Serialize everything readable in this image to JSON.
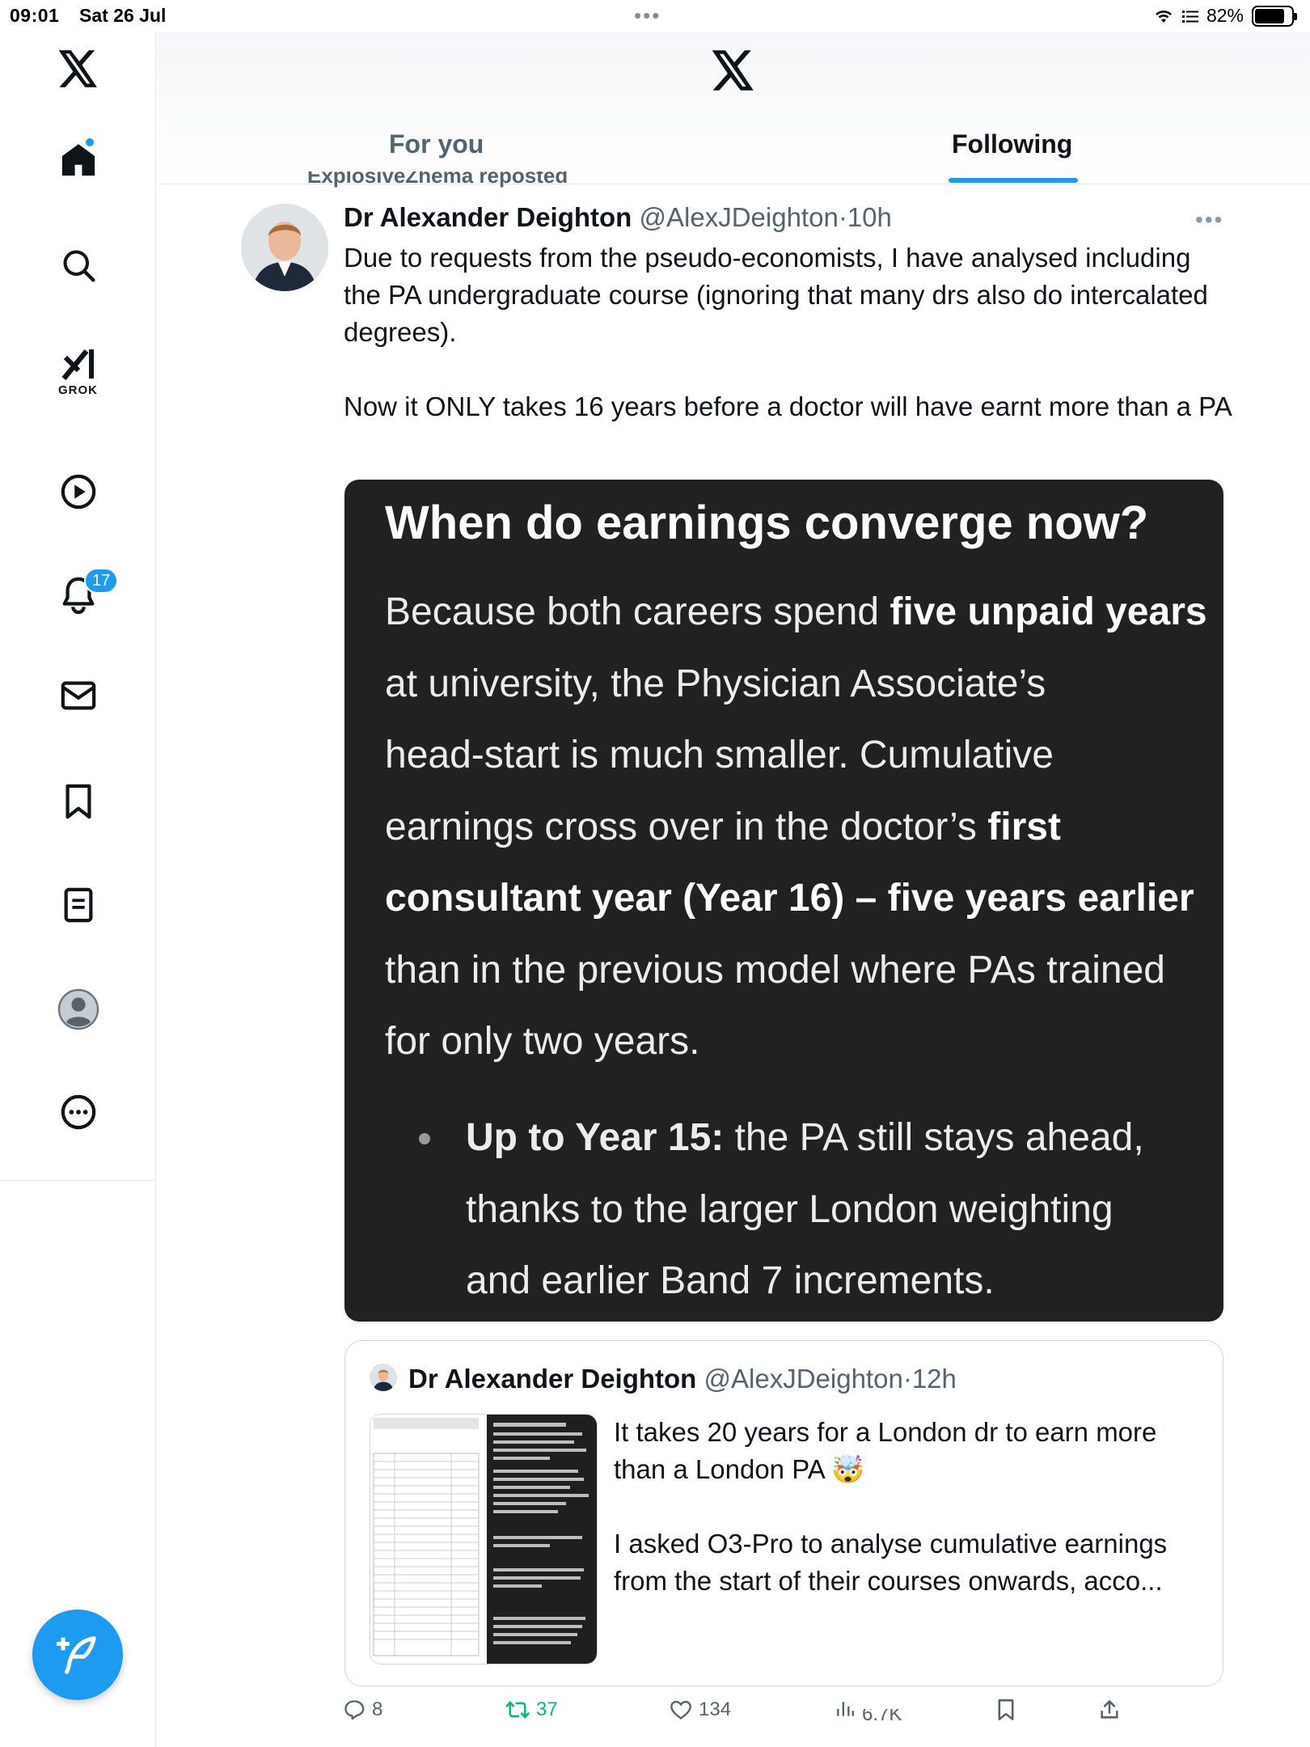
{
  "status_bar": {
    "time": "09:01",
    "date": "Sat 26 Jul",
    "battery": "82%",
    "battery_level": 0.82
  },
  "sidebar": {
    "items": [
      {
        "name": "x-logo",
        "icon": "x-logo"
      },
      {
        "name": "home",
        "icon": "home-icon",
        "has_dot": true
      },
      {
        "name": "search",
        "icon": "search-icon"
      },
      {
        "name": "grok",
        "icon": "grok-icon",
        "label": "GROK"
      },
      {
        "name": "videos",
        "icon": "play-icon"
      },
      {
        "name": "notifications",
        "icon": "bell-icon",
        "badge": "17"
      },
      {
        "name": "messages",
        "icon": "mail-icon"
      },
      {
        "name": "bookmarks",
        "icon": "bookmark-icon"
      },
      {
        "name": "articles",
        "icon": "article-icon"
      },
      {
        "name": "profile",
        "icon": "profile-icon"
      },
      {
        "name": "more",
        "icon": "more-icon"
      }
    ],
    "compose": {
      "icon": "compose-icon"
    }
  },
  "header": {
    "tabs": [
      {
        "label": "For you",
        "active": false
      },
      {
        "label": "Following",
        "active": true
      }
    ]
  },
  "post": {
    "repost_line": "ExplosiveZhema reposted",
    "author_name": "Dr Alexander Deighton",
    "handle": "@AlexJDeighton",
    "separator": "·",
    "time": "10h",
    "more": "•••",
    "text_p1": "Due to requests from the pseudo-economists, I have analysed including the PA undergraduate course (ignoring that many drs also do intercalated degrees).",
    "text_p2": "Now it ONLY takes 16 years before a doctor will have earnt more than a PA",
    "media": {
      "title": "When do earnings converge now?",
      "l1a": "Because both careers spend ",
      "l1b": "five unpaid years",
      "l2": "at university, the Physician Associate’s",
      "l3": "head-start is much smaller. Cumulative",
      "l4a": "earnings cross over in the doctor’s ",
      "l4b": "first",
      "l5": "consultant year (Year 16) – five years earlier",
      "l6": "than in the previous model where PAs trained",
      "l7": "for only two years.",
      "b1a": "Up to Year 15:",
      "b1b": " the PA still stays ahead,",
      "b2": "thanks to the larger London weighting",
      "b3": "and earlier Band 7 increments."
    },
    "quote": {
      "author_name": "Dr Alexander Deighton",
      "handle": "@AlexJDeighton",
      "separator": "·",
      "time": "12h",
      "text_p1": "It takes 20 years for a London dr to earn more than a London PA 🤯",
      "text_p2": "I asked O3-Pro to analyse cumulative earnings from the start of their courses onwards, acco..."
    },
    "actions": {
      "replies": "8",
      "reposts": "37",
      "likes": "134",
      "views": "6.7K"
    }
  }
}
